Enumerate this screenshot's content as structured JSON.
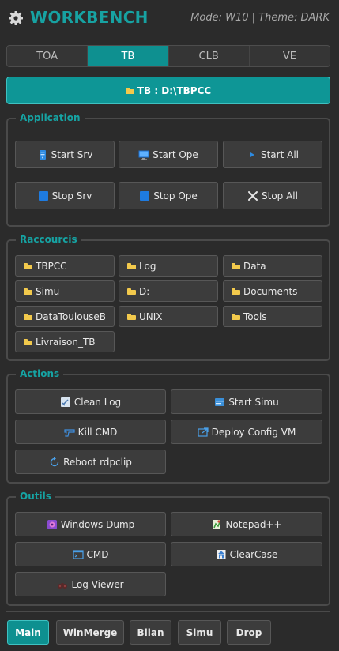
{
  "header": {
    "title": "WORKBENCH",
    "mode_text": "Mode: W10 | Theme: DARK",
    "accent_color": "#17a2a2"
  },
  "tabs": [
    {
      "label": "TOA",
      "active": false
    },
    {
      "label": "TB",
      "active": true
    },
    {
      "label": "CLB",
      "active": false
    },
    {
      "label": "VE",
      "active": false
    }
  ],
  "path_button": {
    "label": "TB : D:\\TBPCC",
    "icon": "folder-icon"
  },
  "application": {
    "title": "Application",
    "buttons": [
      {
        "label": "Start Srv",
        "icon": "server-icon"
      },
      {
        "label": "Start Ope",
        "icon": "monitor-icon"
      },
      {
        "label": "Start All",
        "icon": "play-icon"
      },
      {
        "label": "Stop Srv",
        "icon": "stop-square-icon"
      },
      {
        "label": "Stop Ope",
        "icon": "stop-square-icon"
      },
      {
        "label": "Stop All",
        "icon": "close-icon"
      }
    ]
  },
  "shortcuts": {
    "title": "Raccourcis",
    "items": [
      "TBPCC",
      "Log",
      "Data",
      "Simu",
      "D:",
      "Documents",
      "DataToulouseB",
      "UNIX",
      "Tools",
      "Livraison_TB"
    ]
  },
  "actions": {
    "title": "Actions",
    "buttons": [
      {
        "label": "Clean Log",
        "icon": "broom-icon"
      },
      {
        "label": "Start Simu",
        "icon": "window-icon"
      },
      {
        "label": "Kill CMD",
        "icon": "pistol-icon"
      },
      {
        "label": "Deploy Config VM",
        "icon": "deploy-icon"
      },
      {
        "label": "Reboot rdpclip",
        "icon": "refresh-icon"
      }
    ]
  },
  "tools": {
    "title": "Outils",
    "buttons": [
      {
        "label": "Windows Dump",
        "icon": "dump-icon"
      },
      {
        "label": "Notepad++",
        "icon": "notepad-icon"
      },
      {
        "label": "CMD",
        "icon": "terminal-icon"
      },
      {
        "label": "ClearCase",
        "icon": "clearcase-icon"
      },
      {
        "label": "Log Viewer",
        "icon": "binoculars-icon"
      }
    ]
  },
  "bottom_tabs": [
    {
      "label": "Main",
      "active": true
    },
    {
      "label": "WinMerge",
      "active": false
    },
    {
      "label": "Bilan",
      "active": false
    },
    {
      "label": "Simu",
      "active": false
    },
    {
      "label": "Drop",
      "active": false
    }
  ]
}
